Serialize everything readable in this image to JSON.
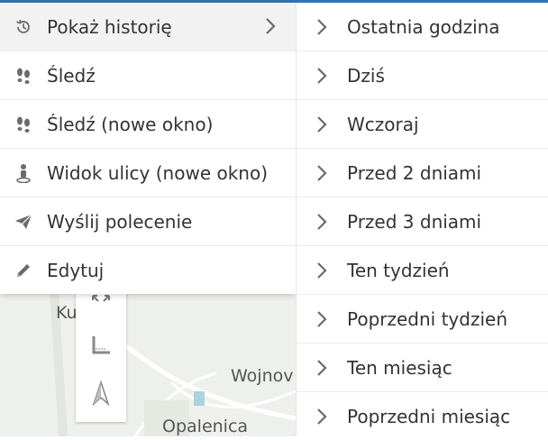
{
  "menu": {
    "items": [
      {
        "label": "Pokaż historię",
        "icon": "history-icon",
        "has_submenu": true
      },
      {
        "label": "Śledź",
        "icon": "footprints-icon"
      },
      {
        "label": "Śledź (nowe okno)",
        "icon": "footprints-icon"
      },
      {
        "label": "Widok ulicy (nowe okno)",
        "icon": "street-view-person-icon"
      },
      {
        "label": "Wyślij polecenie",
        "icon": "paper-plane-icon"
      },
      {
        "label": "Edytuj",
        "icon": "pencil-icon"
      }
    ]
  },
  "submenu": {
    "items": [
      {
        "label": "Ostatnia godzina"
      },
      {
        "label": "Dziś"
      },
      {
        "label": "Wczoraj"
      },
      {
        "label": "Przed 2 dniami"
      },
      {
        "label": "Przed 3 dniami"
      },
      {
        "label": "Ten tydzień"
      },
      {
        "label": "Poprzedni tydzień"
      },
      {
        "label": "Ten miesiąc"
      },
      {
        "label": "Poprzedni miesiąc"
      }
    ]
  },
  "map": {
    "labels": [
      "Ku",
      "Wojnov",
      "Opalenica"
    ]
  },
  "colors": {
    "accent": "#2c74b6",
    "text": "#333333",
    "icon": "#6b6b6b"
  }
}
